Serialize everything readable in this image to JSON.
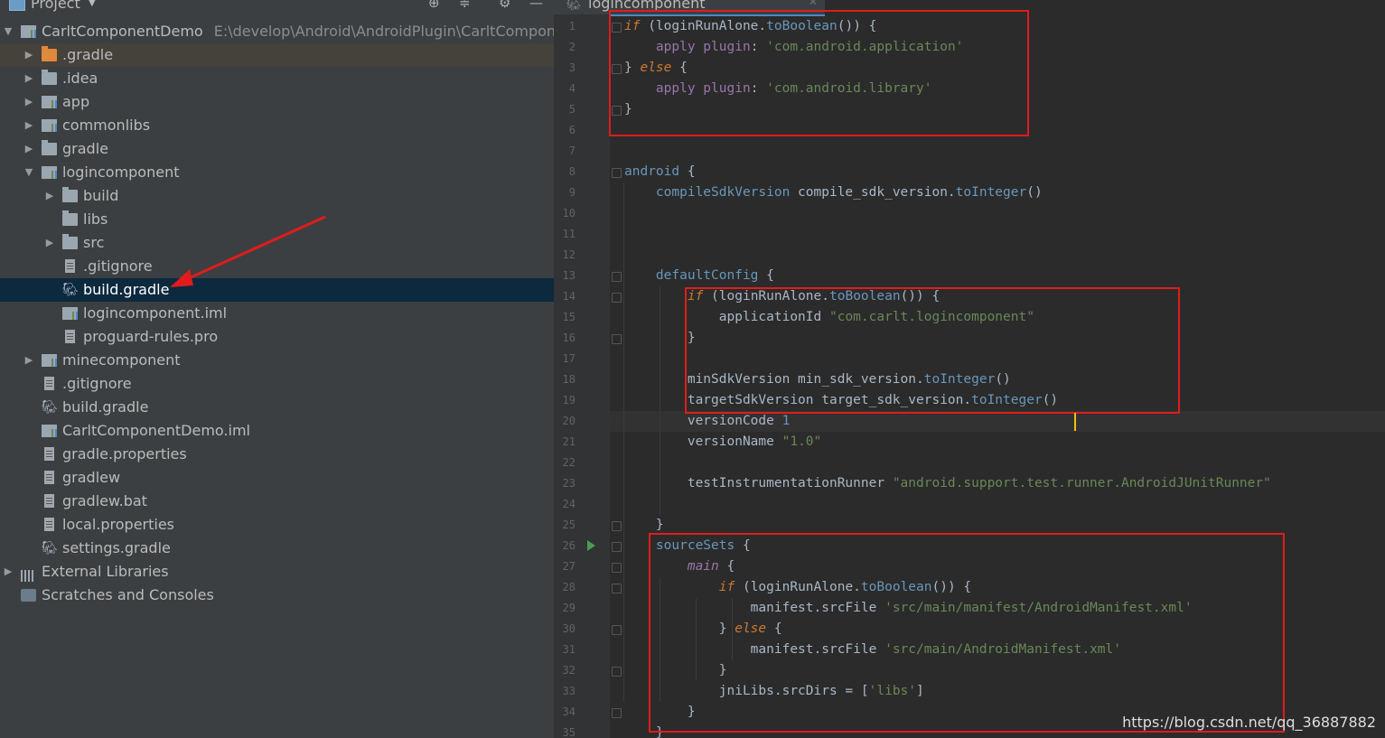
{
  "panel": {
    "title": "Project",
    "dropdown": "▼"
  },
  "tree": [
    {
      "label": "CarltComponentDemo",
      "path": "E:\\develop\\Android\\AndroidPlugin\\CarltCompone",
      "arrow": "▼",
      "icon": "module-icon"
    },
    {
      "label": ".gradle",
      "arrow": "▶",
      "icon": "folder-icon"
    },
    {
      "label": ".idea",
      "arrow": "▶",
      "icon": "folder-icon"
    },
    {
      "label": "app",
      "arrow": "▶",
      "icon": "android-module-icon"
    },
    {
      "label": "commonlibs",
      "arrow": "▶",
      "icon": "module-icon"
    },
    {
      "label": "gradle",
      "arrow": "▶",
      "icon": "folder-icon"
    },
    {
      "label": "logincomponent",
      "arrow": "▼",
      "icon": "module-icon"
    },
    {
      "label": "build",
      "arrow": "▶",
      "icon": "folder-icon"
    },
    {
      "label": "libs",
      "arrow": "",
      "icon": "folder-icon"
    },
    {
      "label": "src",
      "arrow": "▶",
      "icon": "folder-icon"
    },
    {
      "label": ".gitignore",
      "arrow": "",
      "icon": "file-icon"
    },
    {
      "label": "build.gradle",
      "arrow": "",
      "icon": "gradle-icon"
    },
    {
      "label": "logincomponent.iml",
      "arrow": "",
      "icon": "iml-icon"
    },
    {
      "label": "proguard-rules.pro",
      "arrow": "",
      "icon": "file-icon"
    },
    {
      "label": "minecomponent",
      "arrow": "▶",
      "icon": "module-icon"
    },
    {
      "label": ".gitignore",
      "arrow": "",
      "icon": "file-icon"
    },
    {
      "label": "build.gradle",
      "arrow": "",
      "icon": "gradle-icon"
    },
    {
      "label": "CarltComponentDemo.iml",
      "arrow": "",
      "icon": "iml-icon"
    },
    {
      "label": "gradle.properties",
      "arrow": "",
      "icon": "properties-icon"
    },
    {
      "label": "gradlew",
      "arrow": "",
      "icon": "file-icon"
    },
    {
      "label": "gradlew.bat",
      "arrow": "",
      "icon": "file-icon"
    },
    {
      "label": "local.properties",
      "arrow": "",
      "icon": "properties-icon"
    },
    {
      "label": "settings.gradle",
      "arrow": "",
      "icon": "gradle-icon"
    },
    {
      "label": "External Libraries",
      "arrow": "▶",
      "icon": "libraries-icon"
    },
    {
      "label": "Scratches and Consoles",
      "arrow": "",
      "icon": "scratches-icon"
    }
  ],
  "editor": {
    "tab_label": "logincomponent",
    "tab_close": "✕",
    "line_numbers": [
      "1",
      "2",
      "3",
      "4",
      "5",
      "6",
      "7",
      "8",
      "9",
      "10",
      "11",
      "12",
      "13",
      "14",
      "15",
      "16",
      "17",
      "18",
      "19",
      "20",
      "21",
      "22",
      "23",
      "24",
      "25",
      "26",
      "27",
      "28",
      "29",
      "30",
      "31",
      "32",
      "33",
      "34",
      "35"
    ],
    "code": [
      [
        {
          "c": "k",
          "t": "if"
        },
        {
          "c": "t",
          "t": " (loginRunAlone."
        },
        {
          "c": "m",
          "t": "toBoolean"
        },
        {
          "c": "t",
          "t": "()) {"
        }
      ],
      [
        {
          "c": "t",
          "t": "    "
        },
        {
          "c": "p",
          "t": "apply plugin"
        },
        {
          "c": "t",
          "t": ": "
        },
        {
          "c": "s",
          "t": "'com.android.application'"
        }
      ],
      [
        {
          "c": "t",
          "t": "} "
        },
        {
          "c": "k",
          "t": "else"
        },
        {
          "c": "t",
          "t": " {"
        }
      ],
      [
        {
          "c": "t",
          "t": "    "
        },
        {
          "c": "p",
          "t": "apply plugin"
        },
        {
          "c": "t",
          "t": ": "
        },
        {
          "c": "s",
          "t": "'com.android.library'"
        }
      ],
      [
        {
          "c": "t",
          "t": "}"
        }
      ],
      [],
      [],
      [
        {
          "c": "m",
          "t": "android"
        },
        {
          "c": "t",
          "t": " {"
        }
      ],
      [
        {
          "c": "t",
          "t": "    "
        },
        {
          "c": "m",
          "t": "compileSdkVersion"
        },
        {
          "c": "t",
          "t": " compile_sdk_version."
        },
        {
          "c": "m",
          "t": "toInteger"
        },
        {
          "c": "t",
          "t": "()"
        }
      ],
      [],
      [],
      [],
      [
        {
          "c": "t",
          "t": "    "
        },
        {
          "c": "m",
          "t": "defaultConfig"
        },
        {
          "c": "t",
          "t": " {"
        }
      ],
      [
        {
          "c": "t",
          "t": "        "
        },
        {
          "c": "k",
          "t": "if"
        },
        {
          "c": "t",
          "t": " (loginRunAlone."
        },
        {
          "c": "m",
          "t": "toBoolean"
        },
        {
          "c": "t",
          "t": "()) {"
        }
      ],
      [
        {
          "c": "t",
          "t": "            applicationId "
        },
        {
          "c": "s",
          "t": "\"com.carlt.logincomponent\""
        }
      ],
      [
        {
          "c": "t",
          "t": "        }"
        }
      ],
      [],
      [
        {
          "c": "t",
          "t": "        minSdkVersion min_sdk_version."
        },
        {
          "c": "m",
          "t": "toInteger"
        },
        {
          "c": "t",
          "t": "()"
        }
      ],
      [
        {
          "c": "t",
          "t": "        targetSdkVersion target_sdk_version."
        },
        {
          "c": "m",
          "t": "toInteger"
        },
        {
          "c": "t",
          "t": "()"
        }
      ],
      [
        {
          "c": "t",
          "t": "        versionCode "
        },
        {
          "c": "n",
          "t": "1"
        }
      ],
      [
        {
          "c": "t",
          "t": "        versionName "
        },
        {
          "c": "s",
          "t": "\"1.0\""
        }
      ],
      [],
      [
        {
          "c": "t",
          "t": "        testInstrumentationRunner "
        },
        {
          "c": "s",
          "t": "\"android.support.test.runner.AndroidJUnitRunner\""
        }
      ],
      [],
      [
        {
          "c": "t",
          "t": "    }"
        }
      ],
      [
        {
          "c": "t",
          "t": "    "
        },
        {
          "c": "m",
          "t": "sourceSets"
        },
        {
          "c": "t",
          "t": " {"
        }
      ],
      [
        {
          "c": "t",
          "t": "        "
        },
        {
          "c": "ki",
          "t": "main"
        },
        {
          "c": "t",
          "t": " {"
        }
      ],
      [
        {
          "c": "t",
          "t": "            "
        },
        {
          "c": "k",
          "t": "if"
        },
        {
          "c": "t",
          "t": " (loginRunAlone."
        },
        {
          "c": "m",
          "t": "toBoolean"
        },
        {
          "c": "t",
          "t": "()) {"
        }
      ],
      [
        {
          "c": "t",
          "t": "                manifest.srcFile "
        },
        {
          "c": "s",
          "t": "'src/main/manifest/AndroidManifest.xml'"
        }
      ],
      [
        {
          "c": "t",
          "t": "            } "
        },
        {
          "c": "k",
          "t": "else"
        },
        {
          "c": "t",
          "t": " {"
        }
      ],
      [
        {
          "c": "t",
          "t": "                manifest.srcFile "
        },
        {
          "c": "s",
          "t": "'src/main/AndroidManifest.xml'"
        }
      ],
      [
        {
          "c": "t",
          "t": "            }"
        }
      ],
      [
        {
          "c": "t",
          "t": "            jniLibs.srcDirs = ["
        },
        {
          "c": "s",
          "t": "'libs'"
        },
        {
          "c": "t",
          "t": "]"
        }
      ],
      [
        {
          "c": "t",
          "t": "        }"
        }
      ],
      [
        {
          "c": "t",
          "t": "    }"
        }
      ]
    ]
  },
  "watermark": "https://blog.csdn.net/qq_36887882",
  "colors": {
    "highlight_box": "#e01c1c",
    "arrow": "#e01c1c",
    "selection": "#0d293e"
  }
}
